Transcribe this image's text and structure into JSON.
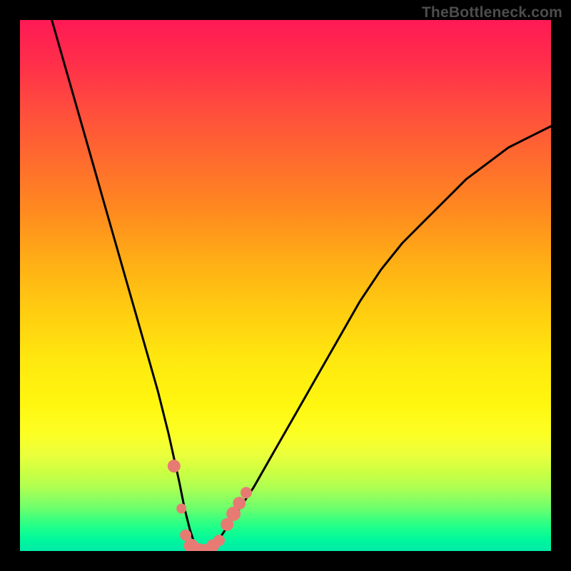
{
  "watermark": "TheBottleneck.com",
  "chart_data": {
    "type": "line",
    "title": "",
    "xlabel": "",
    "ylabel": "",
    "xlim": [
      0,
      100
    ],
    "ylim": [
      0,
      100
    ],
    "grid": false,
    "legend": false,
    "series": [
      {
        "name": "bottleneck-curve",
        "x": [
          6,
          8,
          10,
          12,
          14,
          16,
          18,
          20,
          22,
          24,
          26,
          28,
          30,
          31,
          32,
          33,
          34,
          36,
          38,
          40,
          44,
          48,
          52,
          56,
          60,
          64,
          68,
          72,
          76,
          80,
          84,
          88,
          92,
          96,
          100
        ],
        "y": [
          100,
          93,
          86,
          79,
          72,
          65,
          58,
          51,
          44,
          37,
          30,
          22,
          13,
          8,
          4,
          1,
          0,
          0,
          3,
          6,
          12,
          19,
          26,
          33,
          40,
          47,
          53,
          58,
          62,
          66,
          70,
          73,
          76,
          78,
          80
        ]
      }
    ],
    "markers": [
      {
        "name": "marker",
        "x": 29.0,
        "y": 16,
        "r": 9,
        "color": "#e77b74"
      },
      {
        "name": "marker",
        "x": 30.4,
        "y": 8,
        "r": 7,
        "color": "#e77b74"
      },
      {
        "name": "marker",
        "x": 31.2,
        "y": 3,
        "r": 8,
        "color": "#e77b74"
      },
      {
        "name": "marker",
        "x": 32.2,
        "y": 1,
        "r": 10,
        "color": "#e77b74"
      },
      {
        "name": "marker",
        "x": 33.6,
        "y": 0,
        "r": 11,
        "color": "#e77b74"
      },
      {
        "name": "marker",
        "x": 35.0,
        "y": 0,
        "r": 10,
        "color": "#e77b74"
      },
      {
        "name": "marker",
        "x": 36.3,
        "y": 1,
        "r": 9,
        "color": "#e77b74"
      },
      {
        "name": "marker",
        "x": 37.5,
        "y": 2,
        "r": 8,
        "color": "#e77b74"
      },
      {
        "name": "marker",
        "x": 39.0,
        "y": 5,
        "r": 9,
        "color": "#e77b74"
      },
      {
        "name": "marker",
        "x": 40.2,
        "y": 7,
        "r": 10,
        "color": "#e77b74"
      },
      {
        "name": "marker",
        "x": 41.3,
        "y": 9,
        "r": 9,
        "color": "#e77b74"
      },
      {
        "name": "marker",
        "x": 42.6,
        "y": 11,
        "r": 8,
        "color": "#e77b74"
      }
    ],
    "gradient_stops": [
      {
        "pos": 0.0,
        "color": "#ff1a55"
      },
      {
        "pos": 0.5,
        "color": "#ffe633"
      },
      {
        "pos": 0.93,
        "color": "#33ff88"
      },
      {
        "pos": 1.0,
        "color": "#00eaa8"
      }
    ]
  }
}
